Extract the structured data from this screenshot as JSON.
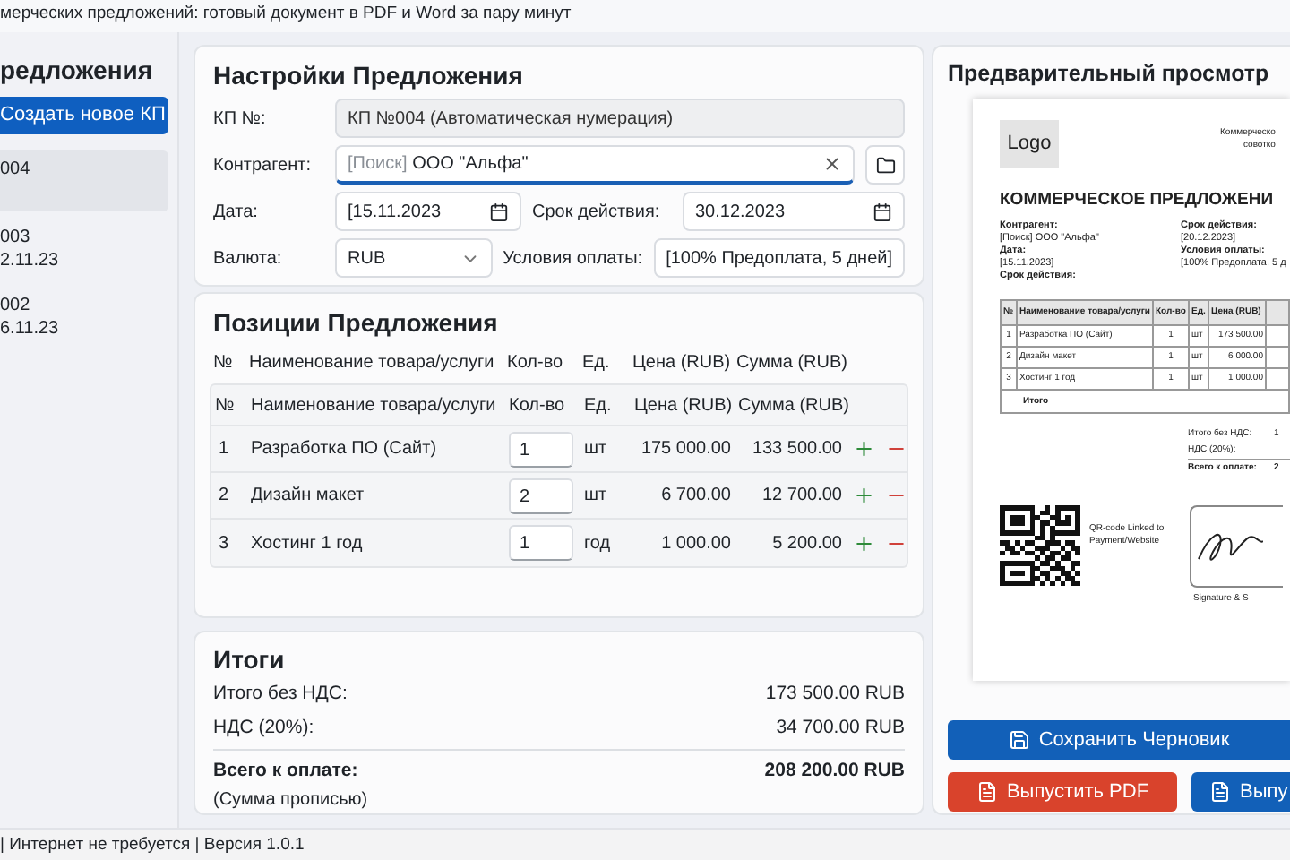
{
  "title_bar": {
    "title": "мерческих предложений: готовый документ в PDF и Word за пару минут"
  },
  "sidebar": {
    "heading": "редложения",
    "create_button": "Создать новое КП",
    "items": [
      {
        "number": "004",
        "selected": true
      },
      {
        "number": "003",
        "date": "2.11.23",
        "selected": false
      },
      {
        "number": "002",
        "date": "6.11.23",
        "selected": false
      }
    ]
  },
  "settings": {
    "heading": "Настройки Предложения",
    "kp_number": {
      "label": "КП №:",
      "value": "КП №004 (Автоматическая нумерация)",
      "disabled": true
    },
    "counterparty": {
      "label": "Контрагент:",
      "hint": "[Поиск]",
      "value": "ООО \"Альфа\"",
      "focused": true
    },
    "date": {
      "label": "Дата:",
      "value": "[15.11.2023"
    },
    "valid_until": {
      "label": "Срок действия:",
      "value": "30.12.2023"
    },
    "currency": {
      "label": "Валюта:",
      "value": "RUB"
    },
    "payment_terms": {
      "label": "Условия оплаты:",
      "value": "[100% Предоплата, 5 дней]"
    }
  },
  "positions": {
    "heading": "Позиции Предложения",
    "header_labels": [
      "№",
      "Наименование товара/услуги",
      "Кол-во",
      "Ед.",
      "Цена (RUB)",
      "Сумма (RUB)"
    ],
    "columns": [
      "№",
      "Наименование товара/услуги",
      "Кол-во",
      "Ед.",
      "Цена (RUB)",
      "Сумма (RUB)"
    ],
    "rows": [
      {
        "no": "1",
        "name": "Разработка ПО (Сайт)",
        "qty": "1",
        "unit": "шт",
        "price": "175 000.00",
        "sum": "133 500.00"
      },
      {
        "no": "2",
        "name": "Дизайн макет",
        "qty": "2",
        "unit": "шт",
        "price": "6 700.00",
        "sum": "12 700.00"
      },
      {
        "no": "3",
        "name": "Хостинг 1 год",
        "qty": "1",
        "unit": "год",
        "price": "1 000.00",
        "sum": "5 200.00"
      }
    ]
  },
  "totals": {
    "heading": "Итоги",
    "rows": [
      {
        "kind": "normal",
        "label": "Итого без НДС:",
        "value": "173 500.00 RUB"
      },
      {
        "kind": "normal",
        "label": "НДС (20%):",
        "value": "34 700.00 RUB"
      },
      {
        "kind": "total",
        "label": "Всего к оплате:",
        "value": "208 200.00 RUB",
        "note": "(Сумма прописью)"
      }
    ]
  },
  "preview": {
    "heading": "Предварительный просмотр",
    "document": {
      "logo": "Logo",
      "company_lines": [
        "Коммерческо",
        "совотко"
      ],
      "title": "КОММЕРЧЕСКОЕ ПРЕДЛОЖЕНИ",
      "left_info": [
        {
          "kind": "label",
          "text": "Контрагент:"
        },
        {
          "kind": "value",
          "text": "[Поиск] ООО \"Альфа\""
        },
        {
          "kind": "label",
          "text": "Дата:"
        },
        {
          "kind": "value",
          "text": "[15.11.2023]"
        },
        {
          "kind": "label",
          "text": "Срок действия:"
        }
      ],
      "right_info": [
        {
          "kind": "label",
          "text": "Срок действия:"
        },
        {
          "kind": "value",
          "text": "[20.12.2023]"
        },
        {
          "kind": "label",
          "text": "Условия оплаты:"
        },
        {
          "kind": "value",
          "text": "[100% Предоплата, 5 д"
        }
      ],
      "columns": [
        "№",
        "Наименование товара/услуги",
        "Кол-во",
        "Ед.",
        "Цена (RUB)"
      ],
      "rows": [
        [
          "1",
          "Разработка ПО (Сайт)",
          "1",
          "шт",
          "173 500.00"
        ],
        [
          "2",
          "Дизайн макет",
          "1",
          "шт",
          "6 000.00"
        ],
        [
          "3",
          "Хостинг 1 год",
          "1",
          "шт",
          "1 000.00"
        ]
      ],
      "table_footer": "Итого",
      "totals": [
        {
          "kind": "normal",
          "label": "Итого без НДС:",
          "value": "1"
        },
        {
          "kind": "normal",
          "label": "НДС (20%):"
        },
        {
          "kind": "total",
          "label": "Всего к оплате:",
          "value": "2"
        }
      ],
      "qr_caption": [
        "QR-code",
        "Linked to",
        "Payment/Website"
      ],
      "signature_caption": "Signature & S"
    },
    "buttons": [
      {
        "kind": "save",
        "label": "Сохранить Черновик"
      },
      {
        "kind": "pdf",
        "label": "Выпустить PDF"
      },
      {
        "kind": "word",
        "label": "Выпу"
      }
    ]
  },
  "status_bar": {
    "text": "| Интернет не требуется | Версия 1.0.1"
  }
}
